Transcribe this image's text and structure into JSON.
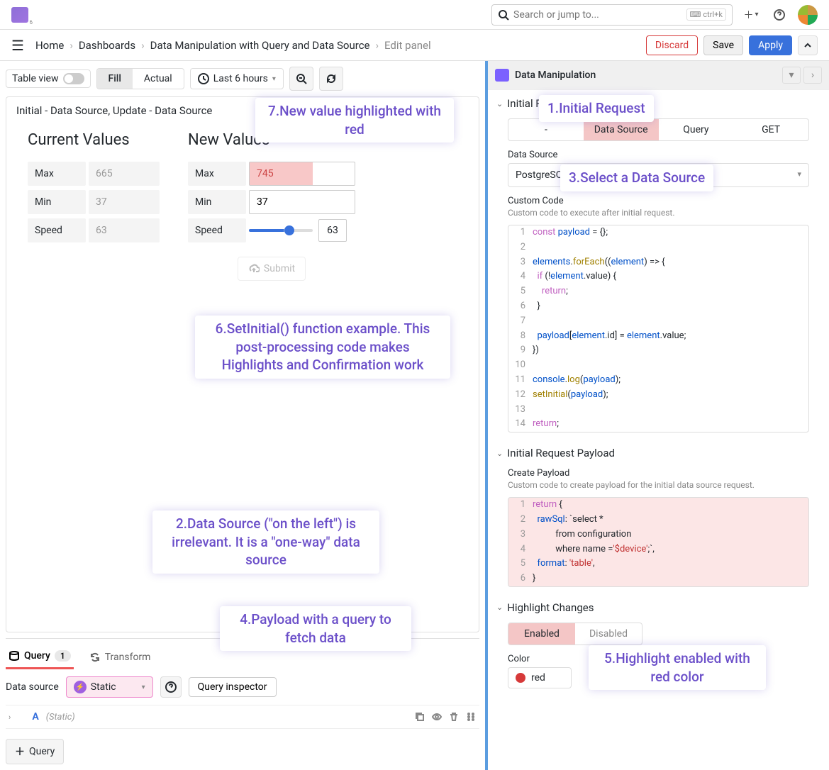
{
  "topbar": {
    "search_placeholder": "Search or jump to...",
    "shortcut": "ctrl+k"
  },
  "breadcrumbs": {
    "items": [
      "Home",
      "Dashboards",
      "Data Manipulation with Query and Data Source",
      "Edit panel"
    ]
  },
  "actions": {
    "discard": "Discard",
    "save": "Save",
    "apply": "Apply"
  },
  "toolbar": {
    "table_view": "Table view",
    "fill": "Fill",
    "actual": "Actual",
    "time_range": "Last 6 hours"
  },
  "panel": {
    "title": "Initial - Data Source, Update - Data Source",
    "current_heading": "Current Values",
    "new_heading": "New Values",
    "rows": {
      "max": {
        "label": "Max",
        "current": "665",
        "new": "745"
      },
      "min": {
        "label": "Min",
        "current": "37",
        "new": "37"
      },
      "speed": {
        "label": "Speed",
        "current": "63",
        "new": "63"
      }
    },
    "submit": "Submit"
  },
  "tabs": {
    "query": "Query",
    "query_badge": "1",
    "transform": "Transform"
  },
  "datasource": {
    "label": "Data source",
    "selected": "Static",
    "inspector": "Query inspector"
  },
  "query_item": {
    "letter": "A",
    "meta": "(Static)"
  },
  "add_query": "Query",
  "right": {
    "header": "Data Manipulation",
    "initial_request": "Initial Request",
    "initial_tabs": [
      "-",
      "Data Source",
      "Query",
      "GET"
    ],
    "ds_label": "Data Source",
    "ds_value": "PostgreSQL",
    "custom_code_label": "Custom Code",
    "custom_code_sub": "Custom code to execute after initial request.",
    "payload_header": "Initial Request Payload",
    "create_payload_label": "Create Payload",
    "create_payload_sub": "Custom code to create payload for the initial data source request.",
    "highlight_header": "Highlight Changes",
    "highlight_opts": [
      "Enabled",
      "Disabled"
    ],
    "color_label": "Color",
    "color_value": "red"
  },
  "code1": [
    {
      "n": "1",
      "t": "const payload = {};"
    },
    {
      "n": "2",
      "t": ""
    },
    {
      "n": "3",
      "t": "elements.forEach((element) => {"
    },
    {
      "n": "4",
      "t": "  if (!element.value) {"
    },
    {
      "n": "5",
      "t": "    return;"
    },
    {
      "n": "6",
      "t": "  }"
    },
    {
      "n": "7",
      "t": ""
    },
    {
      "n": "8",
      "t": "  payload[element.id] = element.value;"
    },
    {
      "n": "9",
      "t": "})"
    },
    {
      "n": "10",
      "t": ""
    },
    {
      "n": "11",
      "t": "console.log(payload);"
    },
    {
      "n": "12",
      "t": "setInitial(payload);"
    },
    {
      "n": "13",
      "t": ""
    },
    {
      "n": "14",
      "t": "return;"
    }
  ],
  "code2": [
    {
      "n": "1",
      "t": "return {"
    },
    {
      "n": "2",
      "t": "  rawSql: `select *"
    },
    {
      "n": "3",
      "t": "          from configuration"
    },
    {
      "n": "4",
      "t": "          where name ='$device';`,"
    },
    {
      "n": "5",
      "t": "  format: 'table',"
    },
    {
      "n": "6",
      "t": "}"
    }
  ],
  "callouts": {
    "c1": "1.Initial Request",
    "c2": "2.Data Source (\"on the left\") is irrelevant. It is a \"one-way\" data source",
    "c3": "3.Select a Data Source",
    "c4": "4.Payload with a query to fetch data",
    "c5": "5.Highlight enabled with red color",
    "c6": "6.SetInitial() function example. This post-processing code makes Highlights and Confirmation work",
    "c7": "7.New value highlighted with red"
  }
}
